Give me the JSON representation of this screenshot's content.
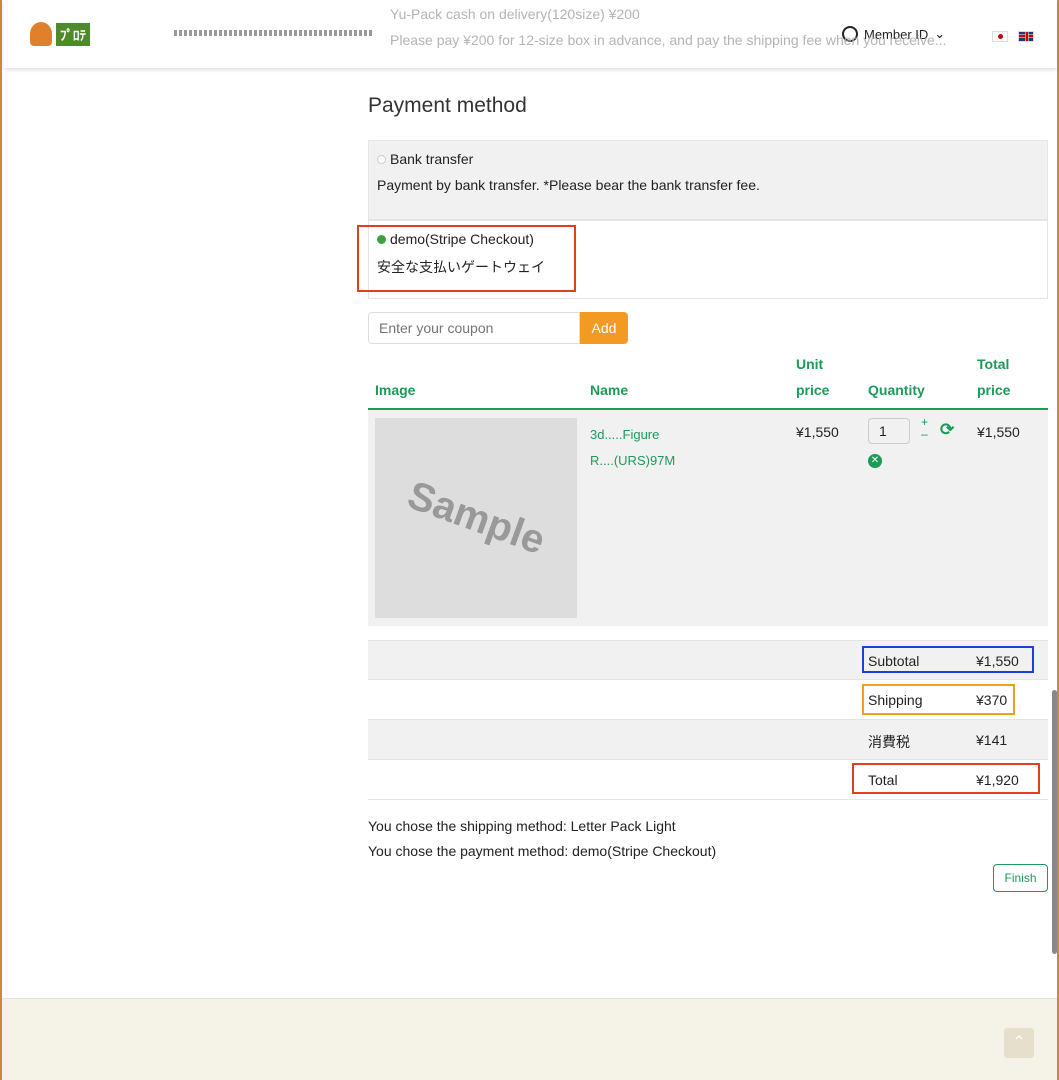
{
  "background_text": {
    "line1": "Yu-Pack cash on delivery(120size) ¥200",
    "line2": "Please pay ¥200 for 12-size box in advance, and pay the shipping fee when you receive..."
  },
  "header": {
    "user_label": "Member ID",
    "icons": [
      "user-icon",
      "chevron-down-icon",
      "flag-jp-icon",
      "flag-gb-icon"
    ]
  },
  "payment": {
    "heading": "Payment method",
    "options": [
      {
        "label": "Bank transfer",
        "desc": "Payment by bank transfer. *Please bear the bank transfer fee.",
        "selected": false
      },
      {
        "label": "demo(Stripe Checkout)",
        "desc": "安全な支払いゲートウェイ",
        "selected": true
      }
    ]
  },
  "coupon": {
    "placeholder": "Enter your coupon",
    "button": "Add"
  },
  "table": {
    "headers": {
      "image": "Image",
      "name": "Name",
      "unit_price_1": "Unit",
      "unit_price_2": "price",
      "quantity": "Quantity",
      "total_1": "Total",
      "total_2": "price"
    },
    "item": {
      "image_text": "Sample",
      "name_line1": "3d.....Figure",
      "name_line2": "R....(URS)97M",
      "unit_price": "¥1,550",
      "quantity": "1",
      "total": "¥1,550"
    }
  },
  "summary": {
    "subtotal_label": "Subtotal",
    "subtotal": "¥1,550",
    "shipping_label": "Shipping",
    "shipping": "¥370",
    "tax_label": "消費税",
    "tax": "¥141",
    "total_label": "Total",
    "total": "¥1,920"
  },
  "info": {
    "shipping": "You chose the shipping method: Letter Pack Light",
    "payment": "You chose the payment method: demo(Stripe Checkout)"
  },
  "finish": "Finish",
  "colors": {
    "accent": "#1c9a5a",
    "orange": "#f39a23",
    "highlight_red": "#e0401c",
    "highlight_blue": "#1c3fe0",
    "highlight_orange": "#f0a020"
  }
}
